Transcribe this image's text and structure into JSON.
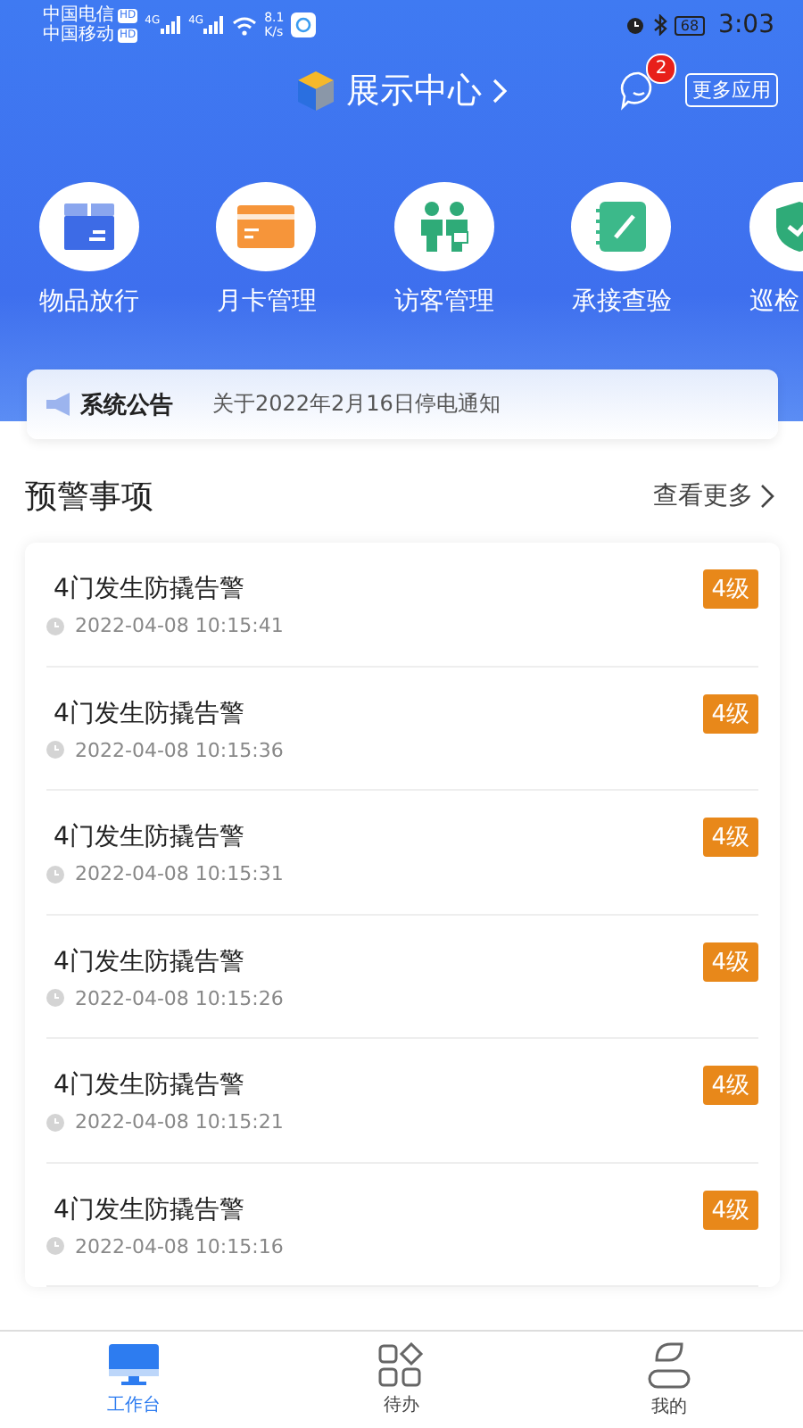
{
  "status_bar": {
    "carriers": [
      {
        "name": "中国电信",
        "badge": "HD"
      },
      {
        "name": "中国移动",
        "badge": "HD"
      }
    ],
    "network_labels": [
      "4G",
      "4G"
    ],
    "speed": "8.1",
    "speed_unit": "K/s",
    "battery": "68",
    "time": "3:03"
  },
  "header": {
    "title": "展示中心",
    "notification_count": "2",
    "more_apps": "更多应用"
  },
  "shortcuts": [
    {
      "label": "物品放行",
      "kind": "box"
    },
    {
      "label": "月卡管理",
      "kind": "card"
    },
    {
      "label": "访客管理",
      "kind": "people"
    },
    {
      "label": "承接查验",
      "kind": "notebook"
    },
    {
      "label": "巡检",
      "kind": "shield"
    }
  ],
  "notice": {
    "label": "系统公告",
    "text": "关于2022年2月16日停电通知"
  },
  "alerts": {
    "title": "预警事项",
    "more": "查看更多",
    "items": [
      {
        "title": "4门发生防撬告警",
        "time": "2022-04-08 10:15:41",
        "grade": "4级"
      },
      {
        "title": "4门发生防撬告警",
        "time": "2022-04-08 10:15:36",
        "grade": "4级"
      },
      {
        "title": "4门发生防撬告警",
        "time": "2022-04-08 10:15:31",
        "grade": "4级"
      },
      {
        "title": "4门发生防撬告警",
        "time": "2022-04-08 10:15:26",
        "grade": "4级"
      },
      {
        "title": "4门发生防撬告警",
        "time": "2022-04-08 10:15:21",
        "grade": "4级"
      },
      {
        "title": "4门发生防撬告警",
        "time": "2022-04-08 10:15:16",
        "grade": "4级"
      }
    ]
  },
  "tab_bar": [
    {
      "label": "工作台",
      "kind": "desk",
      "selected": true
    },
    {
      "label": "待办",
      "kind": "grid",
      "selected": false
    },
    {
      "label": "我的",
      "kind": "person",
      "selected": false
    }
  ]
}
